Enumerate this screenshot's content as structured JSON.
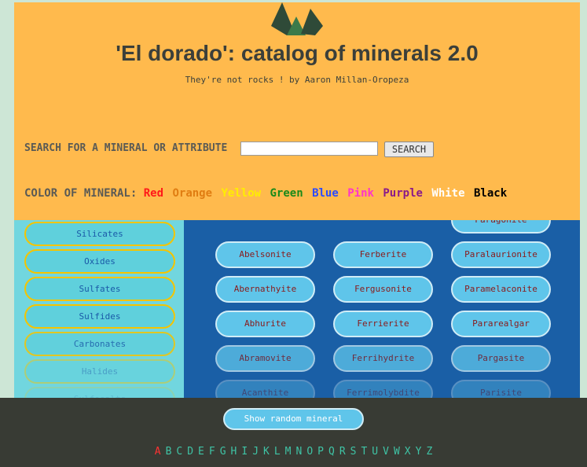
{
  "header": {
    "title": "'El dorado': catalog of minerals 2.0",
    "subtitle": "They're not rocks ! by Aaron Millan-Oropeza",
    "logo_icon": "mountain-logo-icon"
  },
  "search": {
    "label": "SEARCH FOR A MINERAL OR ATTRIBUTE",
    "value": "",
    "button": "SEARCH"
  },
  "colors": {
    "label": "COLOR OF MINERAL:",
    "items": [
      {
        "name": "Red",
        "hex": "#ff1a1a"
      },
      {
        "name": "Orange",
        "hex": "#e07d12"
      },
      {
        "name": "Yellow",
        "hex": "#ffee00"
      },
      {
        "name": "Green",
        "hex": "#1a8a1a"
      },
      {
        "name": "Blue",
        "hex": "#2b4bff"
      },
      {
        "name": "Pink",
        "hex": "#ff33cc"
      },
      {
        "name": "Purple",
        "hex": "#8a1a8a"
      },
      {
        "name": "White",
        "hex": "#ffffff"
      },
      {
        "name": "Black",
        "hex": "#000000"
      }
    ]
  },
  "sidebar": {
    "categories": [
      "Silicates",
      "Oxides",
      "Sulfates",
      "Sulfides",
      "Carbonates",
      "Halides",
      "Sulfosalts"
    ]
  },
  "minerals": {
    "col1": [
      "Abelsonite",
      "Abernathyite",
      "Abhurite",
      "Abramovite",
      "Acanthite"
    ],
    "col2": [
      "Ferberite",
      "Fergusonite",
      "Ferrierite",
      "Ferrihydrite",
      "Ferrimolybdite"
    ],
    "col3": [
      "Paragonite",
      "Paralaurionite",
      "Paramelaconite",
      "Pararealgar",
      "Pargasite",
      "Parisite"
    ]
  },
  "footer": {
    "random_button": "Show random mineral",
    "alphabet": [
      "A",
      "B",
      "C",
      "D",
      "E",
      "F",
      "G",
      "H",
      "I",
      "J",
      "K",
      "L",
      "M",
      "N",
      "O",
      "P",
      "Q",
      "R",
      "S",
      "T",
      "U",
      "V",
      "W",
      "X",
      "Y",
      "Z"
    ],
    "active_letter": "A"
  }
}
